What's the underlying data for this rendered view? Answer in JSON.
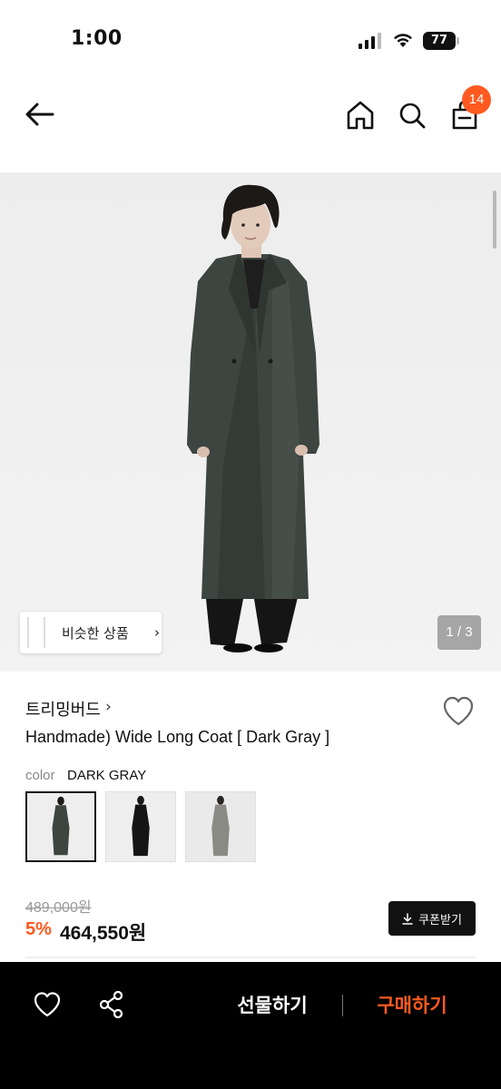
{
  "status_bar": {
    "time": "1:00",
    "battery": "77"
  },
  "header": {
    "cart_badge": "14"
  },
  "gallery": {
    "similar_label": "비슷한 상품",
    "page_counter": "1 / 3"
  },
  "product": {
    "brand": "트리밍버드",
    "title": "Handmade) Wide Long Coat [ Dark Gray ]",
    "color_label": "color",
    "color_value": "DARK GRAY",
    "original_price": "489,000원",
    "discount_rate": "5%",
    "sale_price": "464,550원",
    "coupon_label": "쿠폰받기"
  },
  "bottom_bar": {
    "gift_label": "선물하기",
    "buy_label": "구매하기"
  },
  "colors": {
    "accent": "#ff5a1f",
    "coat_dark_gray": "#3d4540",
    "bottom_bar_bg": "#000000"
  },
  "icons": [
    "back-arrow-icon",
    "home-icon",
    "search-icon",
    "cart-icon",
    "heart-icon",
    "share-icon",
    "download-icon",
    "chevron-right-icon"
  ]
}
